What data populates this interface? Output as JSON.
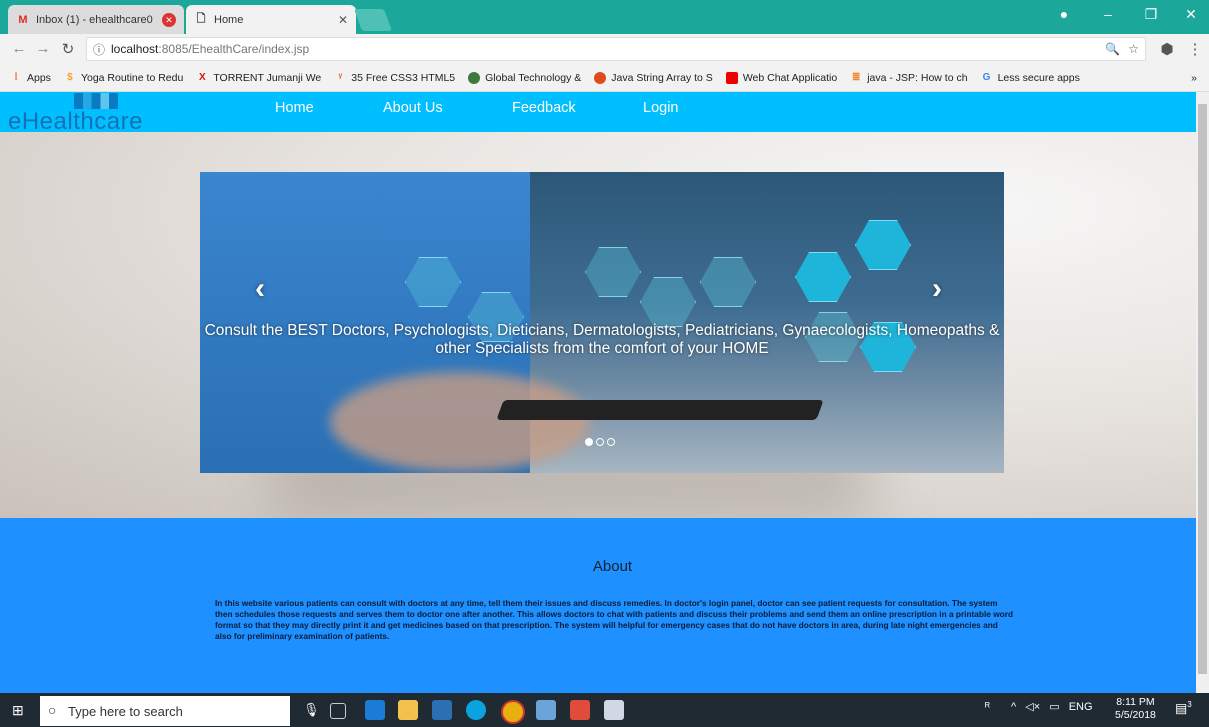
{
  "browser": {
    "tabs": [
      {
        "label": "Inbox (1) - ehealthcare0",
        "icon": "gmail-icon"
      },
      {
        "label": "Home",
        "icon": "page-icon"
      }
    ],
    "url_host": "localhost",
    "url_path": ":8085/EhealthCare/index.jsp",
    "bookmarks": [
      {
        "label": "Apps",
        "icon": "apps-icon",
        "color": "#e8501e"
      },
      {
        "label": "Yoga Routine to Redu",
        "icon": "dollar-icon",
        "color": "#f5a623"
      },
      {
        "label": "TORRENT Jumanji We",
        "icon": "x-icon",
        "color": "#d11"
      },
      {
        "label": "35 Free CSS3 HTML5",
        "icon": "css-icon",
        "color": "#e05a2b"
      },
      {
        "label": "Global Technology &",
        "icon": "globe-icon",
        "color": "#3b7a3b"
      },
      {
        "label": "Java String Array to S",
        "icon": "java-icon",
        "color": "#e14b1b"
      },
      {
        "label": "Web Chat Applicatio",
        "icon": "youtube-icon",
        "color": "#e00"
      },
      {
        "label": "java - JSP: How to ch",
        "icon": "stack-icon",
        "color": "#f48024"
      },
      {
        "label": "Less secure apps",
        "icon": "google-icon",
        "color": "#4285f4"
      }
    ],
    "more_label": "»"
  },
  "site": {
    "logo": "eHealthcare",
    "nav": [
      "Home",
      "About Us",
      "Feedback",
      "Login"
    ],
    "caption": "Consult the BEST Doctors, Psychologists, Dieticians, Dermatologists, Pediatricians, Gynaecologists, Homeopaths & other Specialists from the comfort of your HOME",
    "prev_arrow": "‹",
    "next_arrow": "›",
    "about_title": "About",
    "about_text": "In this website various patients can consult with doctors at any time, tell them their issues and discuss remedies. In doctor's login panel, doctor can see patient requests for consultation. The system then schedules those requests and serves them to doctor one after another. This allows doctors to chat with patients and discuss their problems and send them an online prescription in a printable word format so that they may directly print it and get medicines based on that prescription. The system will helpful for emergency cases that do not have doctors in area, during late night emergencies and also for preliminary examination of patients."
  },
  "taskbar": {
    "search_placeholder": "Type here to search",
    "tray_lang": "ENG",
    "time": "8:11 PM",
    "date": "5/5/2018",
    "notif_count": "3"
  },
  "colors": {
    "navbar": "#00bfff",
    "about_bg": "#1e90ff",
    "tab_strip": "#1ba89a"
  }
}
